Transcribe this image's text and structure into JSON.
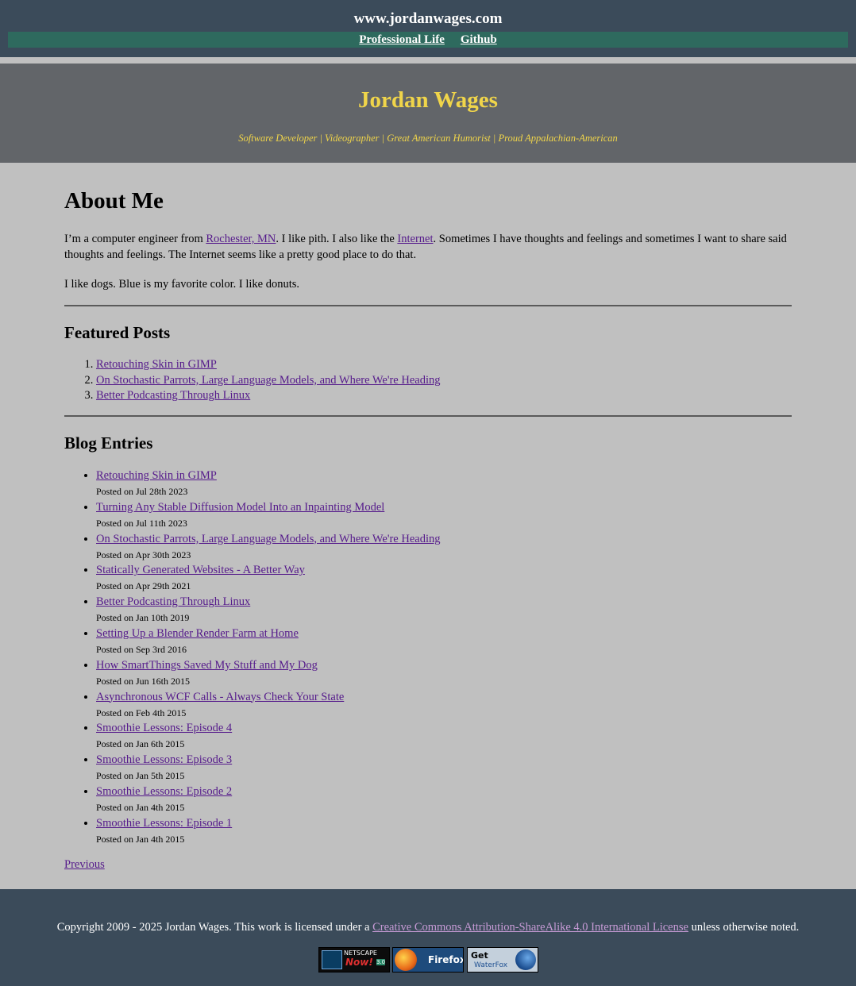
{
  "topbar": {
    "site_name": "www.jordanwages.com",
    "nav": [
      "Professional Life",
      "Github"
    ]
  },
  "hero": {
    "title": "Jordan Wages",
    "subtitle": "Software Developer | Videographer | Great American Humorist | Proud Appalachian-American"
  },
  "about": {
    "heading": "About Me",
    "p1_before": "I’m a computer engineer from ",
    "p1_link1": "Rochester, MN",
    "p1_mid": ". I like pith. I also like the ",
    "p1_link2": "Internet",
    "p1_after": ". Sometimes I have thoughts and feelings and sometimes I want to share said thoughts and feelings. The Internet seems like a pretty good place to do that.",
    "p2": "I like dogs. Blue is my favorite color. I like donuts."
  },
  "featured": {
    "heading": "Featured Posts",
    "items": [
      "Retouching Skin in GIMP",
      "On Stochastic Parrots, Large Language Models, and Where We're Heading",
      "Better Podcasting Through Linux"
    ]
  },
  "blog": {
    "heading": "Blog Entries",
    "entries": [
      {
        "title": "Retouching Skin in GIMP",
        "date": "Posted on Jul 28th 2023"
      },
      {
        "title": "Turning Any Stable Diffusion Model Into an Inpainting Model",
        "date": "Posted on Jul 11th 2023"
      },
      {
        "title": "On Stochastic Parrots, Large Language Models, and Where We're Heading",
        "date": "Posted on Apr 30th 2023"
      },
      {
        "title": "Statically Generated Websites - A Better Way",
        "date": "Posted on Apr 29th 2021"
      },
      {
        "title": "Better Podcasting Through Linux",
        "date": "Posted on Jan 10th 2019"
      },
      {
        "title": "Setting Up a Blender Render Farm at Home",
        "date": "Posted on Sep 3rd 2016"
      },
      {
        "title": "How SmartThings Saved My Stuff and My Dog",
        "date": "Posted on Jun 16th 2015"
      },
      {
        "title": "Asynchronous WCF Calls - Always Check Your State",
        "date": "Posted on Feb 4th 2015"
      },
      {
        "title": "Smoothie Lessons: Episode 4",
        "date": "Posted on Jan 6th 2015"
      },
      {
        "title": "Smoothie Lessons: Episode 3",
        "date": "Posted on Jan 5th 2015"
      },
      {
        "title": "Smoothie Lessons: Episode 2",
        "date": "Posted on Jan 4th 2015"
      },
      {
        "title": "Smoothie Lessons: Episode 1",
        "date": "Posted on Jan 4th 2015"
      }
    ],
    "previous": "Previous"
  },
  "footer": {
    "copyright_before": "Copyright 2009 - 2025 Jordan Wages. This work is licensed under a ",
    "license_link": "Creative Commons Attribution-ShareAlike 4.0 International License",
    "copyright_after": " unless otherwise noted.",
    "badges": [
      {
        "name": "netscape-now-badge",
        "line1": "NETSCAPE",
        "line2": "Now!",
        "line3": "3.0"
      },
      {
        "name": "firefox-badge",
        "line1": "Firefox"
      },
      {
        "name": "waterfox-badge",
        "line1": "Get",
        "line2": "WaterFox"
      }
    ]
  },
  "colors": {
    "header_bg": "#3b4b5a",
    "nav_bg": "#2e6a5e",
    "hero_bg": "#626569",
    "hero_text": "#f0d54a",
    "page_bg": "#c0c0c0",
    "link": "#551a8b"
  }
}
